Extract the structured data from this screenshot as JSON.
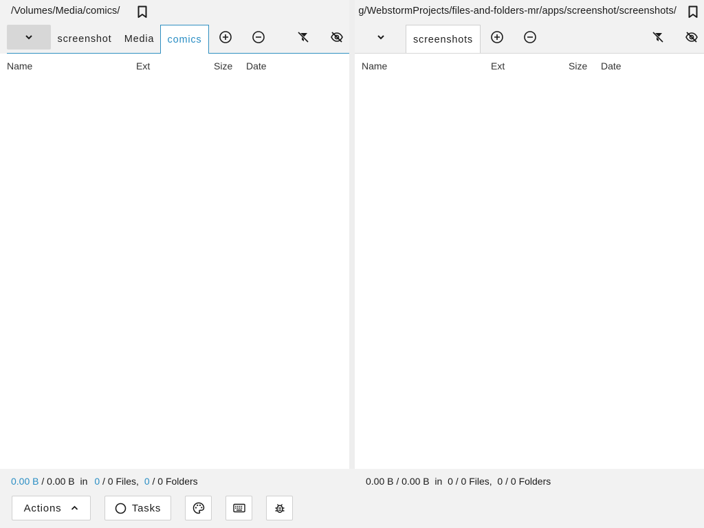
{
  "panes": {
    "left": {
      "path": "/Volumes/Media/comics/",
      "tabs": [
        "screenshot",
        "Media",
        "comics"
      ],
      "active_tab": "comics",
      "columns": {
        "name": "Name",
        "ext": "Ext",
        "size": "Size",
        "date": "Date"
      },
      "status": {
        "selected_size": "0.00 B",
        "total_size": "0.00 B",
        "in": "in",
        "selected_files": "0",
        "files_rest": "/ 0 Files,",
        "selected_folders": "0",
        "folders_rest": "/ 0 Folders"
      }
    },
    "right": {
      "path": "g/WebstormProjects/files-and-folders-mr/apps/screenshot/screenshots/",
      "tabs": [
        "screenshots"
      ],
      "active_tab": "screenshots",
      "columns": {
        "name": "Name",
        "ext": "Ext",
        "size": "Size",
        "date": "Date"
      },
      "status": {
        "text": "0.00 B / 0.00 B  in  0 / 0 Files,  0 / 0 Folders"
      }
    }
  },
  "toolbar": {
    "actions_label": "Actions",
    "tasks_label": "Tasks"
  },
  "icons": {
    "bookmark": "bookmark-icon",
    "chevron_down": "chevron-down-icon",
    "add": "add-circle-icon",
    "remove": "remove-circle-icon",
    "filter_off": "filter-off-icon",
    "visibility_off": "visibility-off-icon",
    "chevron_up": "chevron-up-icon",
    "circle": "circle-icon",
    "palette": "palette-icon",
    "keyboard": "keyboard-icon",
    "bug": "bug-icon"
  },
  "colors": {
    "accent": "#2a8ec4",
    "background": "#f2f2f2",
    "list_background": "#ffffff"
  }
}
